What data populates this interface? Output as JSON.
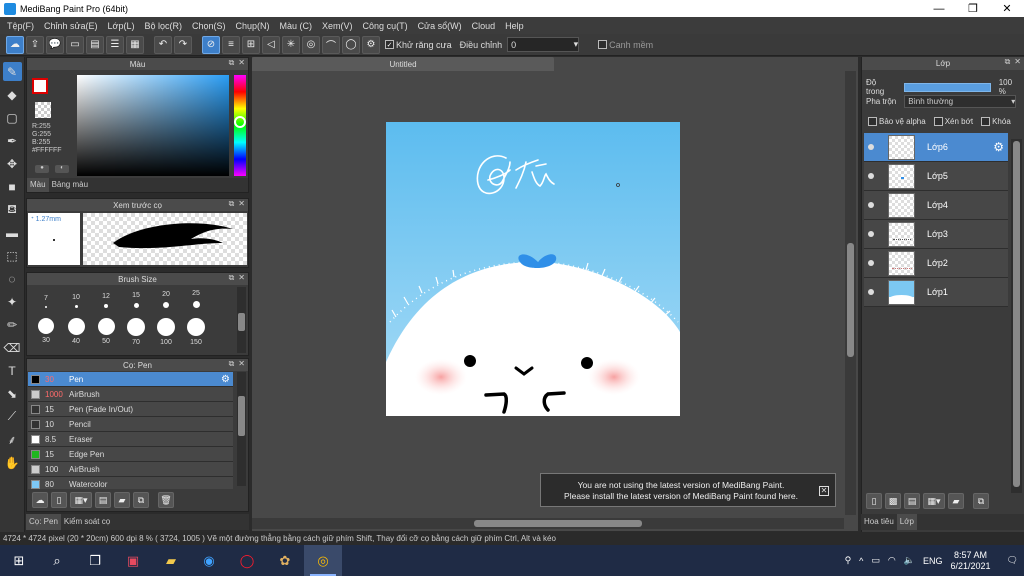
{
  "window": {
    "title": "MediBang Paint Pro (64bit)",
    "minimize_glyph": "—",
    "maximize_glyph": "❐",
    "close_glyph": "✕"
  },
  "menu": [
    "Tệp(F)",
    "Chỉnh sửa(E)",
    "Lớp(L)",
    "Bộ lọc(R)",
    "Chọn(S)",
    "Chụp(N)",
    "Màu (C)",
    "Xem(V)",
    "Công cụ(T)",
    "Cửa sổ(W)",
    "Cloud",
    "Help"
  ],
  "toolbar": {
    "antialias_label": "Khử răng cưa",
    "adjust_label": "Điều chỉnh",
    "adjust_value": "0",
    "snap_label": "Canh mềm"
  },
  "panels": {
    "color": {
      "title": "Màu",
      "rgb": [
        "R:255",
        "G:255",
        "B:255"
      ],
      "hex": "#FFFFFF",
      "tab_color": "Màu",
      "tab_palette": "Bảng màu"
    },
    "preview": {
      "title": "Xem trước cọ",
      "size": "1.27mm"
    },
    "brush_size": {
      "title": "Brush Size",
      "sizes": [
        {
          "label": "7",
          "d": 2
        },
        {
          "label": "10",
          "d": 3
        },
        {
          "label": "12",
          "d": 4
        },
        {
          "label": "15",
          "d": 5
        },
        {
          "label": "20",
          "d": 6
        },
        {
          "label": "25",
          "d": 7
        },
        {
          "label": "30",
          "d": 16
        },
        {
          "label": "40",
          "d": 17
        },
        {
          "label": "50",
          "d": 17
        },
        {
          "label": "70",
          "d": 18
        },
        {
          "label": "100",
          "d": 18
        },
        {
          "label": "150",
          "d": 18
        }
      ]
    },
    "brush": {
      "title": "Cọ: Pen",
      "items": [
        {
          "size": "30",
          "name": "Pen",
          "color": "#000000",
          "selected": true
        },
        {
          "size": "1000",
          "name": "AirBrush",
          "color": "#cccccc"
        },
        {
          "size": "15",
          "name": "Pen (Fade In/Out)",
          "color": "#333333"
        },
        {
          "size": "10",
          "name": "Pencil",
          "color": "#333333"
        },
        {
          "size": "8.5",
          "name": "Eraser",
          "color": "#ffffff"
        },
        {
          "size": "15",
          "name": "Edge Pen",
          "color": "#1fb71f"
        },
        {
          "size": "100",
          "name": "AirBrush",
          "color": "#cccccc"
        },
        {
          "size": "80",
          "name": "Watercolor",
          "color": "#7ec8f5"
        }
      ]
    },
    "left_tabs": [
      "Cọ: Pen",
      "Kiểm soát cọ"
    ]
  },
  "canvas": {
    "doc_title": "Untitled",
    "notice_line1": "You are not using the latest version of MediBang Paint.",
    "notice_line2": "Please install the latest version of MediBang Paint found here."
  },
  "layers": {
    "title": "Lớp",
    "opacity_label": "Độ trong",
    "opacity_value": "100 %",
    "opacity_percent": 100,
    "blend_label": "Pha trộn",
    "blend_value": "Bình thường",
    "protect_alpha": "Bảo vệ alpha",
    "clipping": "Xén bớt",
    "lock": "Khóa",
    "items": [
      {
        "name": "Lớp6",
        "selected": true
      },
      {
        "name": "Lớp5"
      },
      {
        "name": "Lớp4"
      },
      {
        "name": "Lớp3"
      },
      {
        "name": "Lớp2"
      },
      {
        "name": "Lớp1"
      }
    ],
    "tabs": [
      "Hoa tiêu",
      "Lớp"
    ]
  },
  "status": "4724 * 4724 pixel  (20 * 20cm)  600 dpi  8 %  ( 3724, 1005 )  Vẽ một đường thẳng bằng cách giữ phím Shift, Thay đổi cỡ cọ bằng cách giữ phím Ctrl, Alt và kéo",
  "taskbar": {
    "lang": "ENG",
    "time": "8:57 AM",
    "date": "6/21/2021"
  },
  "colors": {
    "accent": "#4b8ad0",
    "sky": "#7cc8f2",
    "heart": "#2f8fe8",
    "blush": "#f7a9a9"
  }
}
